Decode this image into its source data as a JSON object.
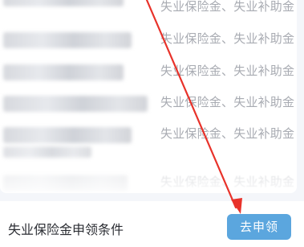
{
  "list": {
    "rows": [
      {
        "benefits": "失业保险金、失业补助金"
      },
      {
        "benefits": "失业保险金、失业补助金"
      },
      {
        "benefits": "失业保险金、失业补助金"
      },
      {
        "benefits": "失业保险金、失业补助金"
      },
      {
        "benefits": "失业保险金、失业补助金"
      },
      {
        "benefits": "失业保险金、失业补助金"
      }
    ]
  },
  "bottom_bar": {
    "title": "失业保险金申领条件",
    "apply_label": "去申领"
  },
  "annotation": {
    "color": "#e8322a"
  }
}
